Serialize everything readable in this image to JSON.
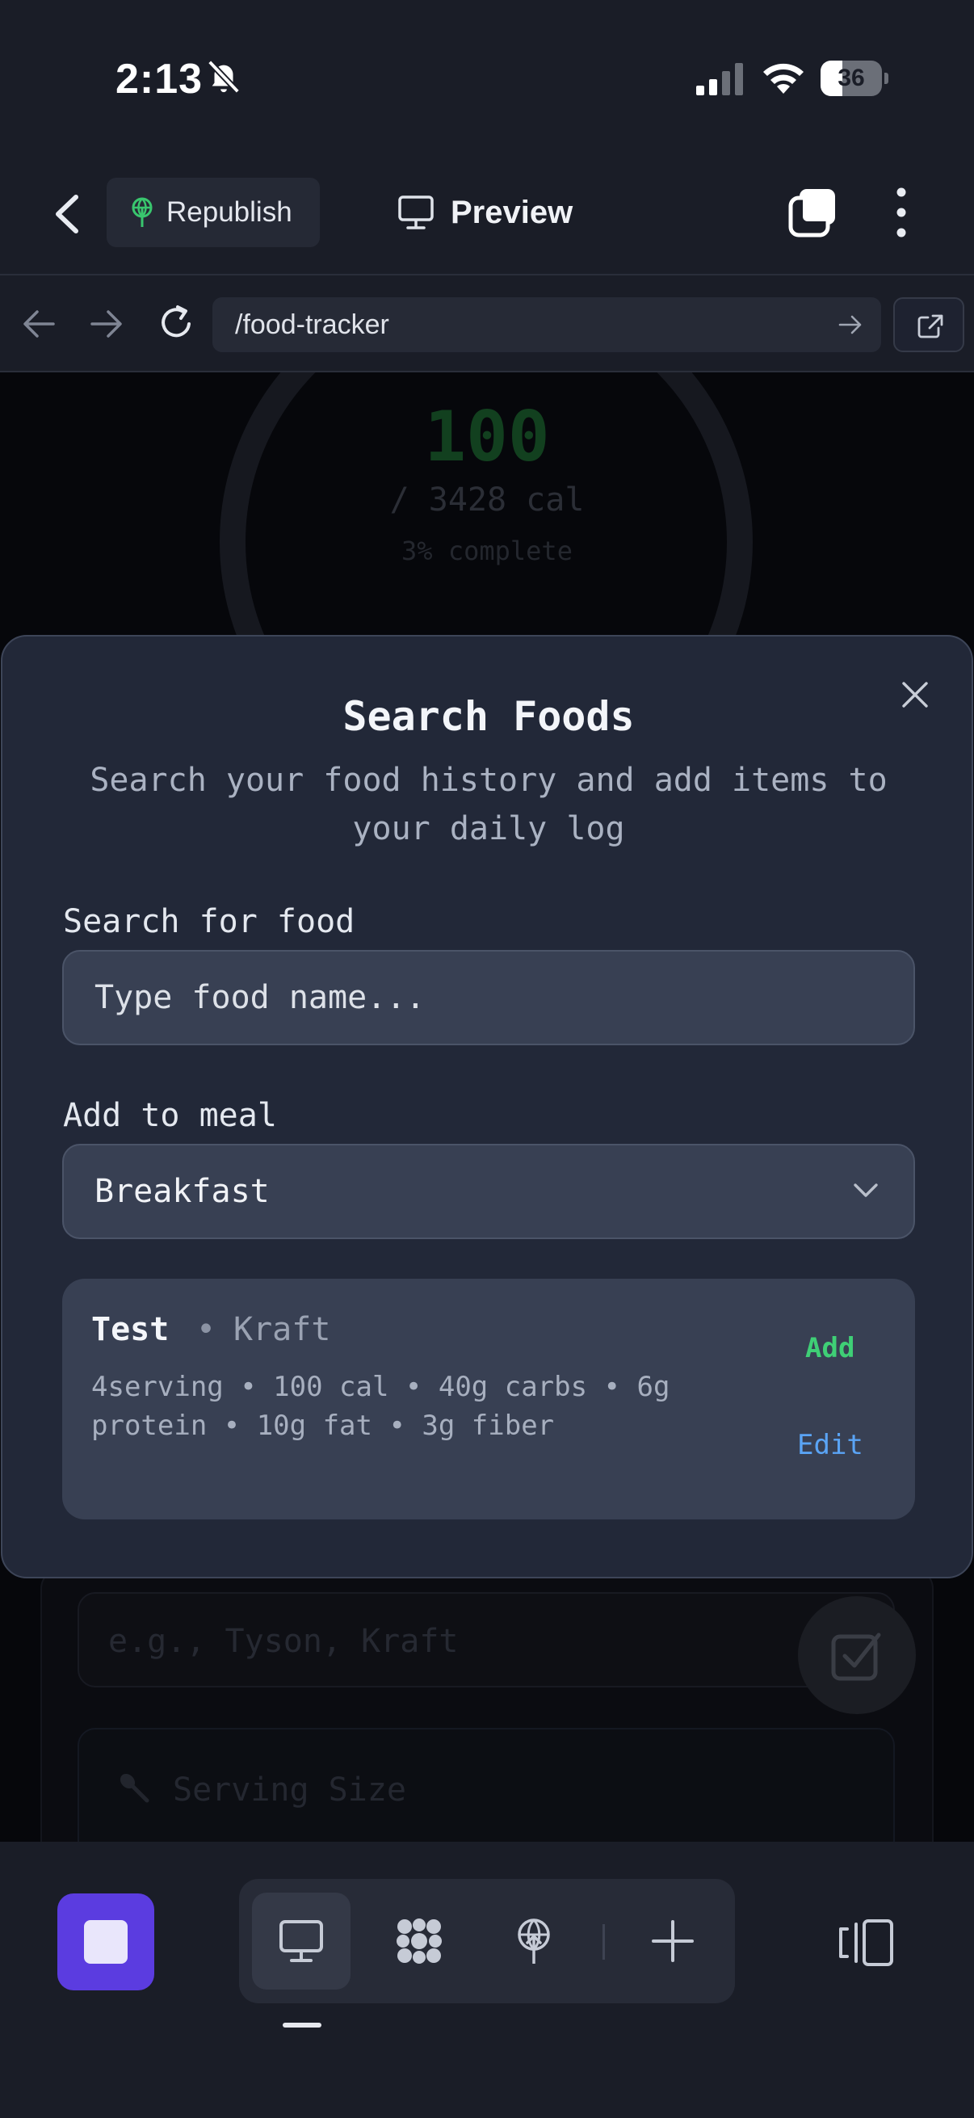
{
  "status_bar": {
    "time": "2:13",
    "battery_level": "36",
    "battery_fraction": 0.36,
    "icons": [
      "bell-slash-icon",
      "signal-icon",
      "wifi-icon",
      "battery-icon"
    ]
  },
  "toolbar": {
    "republish_label": "Republish",
    "preview_label": "Preview",
    "icons": [
      "chevron-left-icon",
      "antenna-icon",
      "monitor-icon",
      "tabs-icon",
      "more-vertical-icon"
    ]
  },
  "url_bar": {
    "url": "/food-tracker",
    "icons": [
      "arrow-left-icon",
      "arrow-right-icon",
      "reload-icon",
      "go-arrow-icon",
      "external-link-icon"
    ]
  },
  "background_app": {
    "calories_consumed": "100",
    "calories_goal": "/ 3428 cal",
    "percent_complete": "3% complete",
    "brand_placeholder": "e.g., Tyson, Kraft",
    "serving_size_label": "Serving Size"
  },
  "modal": {
    "title": "Search Foods",
    "subtitle": "Search your food history and add items to your daily log",
    "search_label": "Search for food",
    "search_placeholder": "Type food name...",
    "meal_label": "Add to meal",
    "meal_selected": "Breakfast",
    "result": {
      "name": "Test",
      "separator": "•",
      "brand": "Kraft",
      "nutrition": "4serving • 100 cal • 40g carbs • 6g protein • 10g fat • 3g fiber",
      "add_label": "Add",
      "edit_label": "Edit"
    }
  },
  "bottom_bar": {
    "active_tab": "monitor",
    "icons": [
      "stop-icon",
      "monitor-icon",
      "apps-icon",
      "publish-icon",
      "plus-icon",
      "sidebar-icon"
    ]
  },
  "colors": {
    "accent_purple": "#5b3ce0",
    "add_green": "#3fcf76",
    "edit_blue": "#5aa4f5",
    "modal_bg": "#222838",
    "input_bg": "#384053"
  }
}
